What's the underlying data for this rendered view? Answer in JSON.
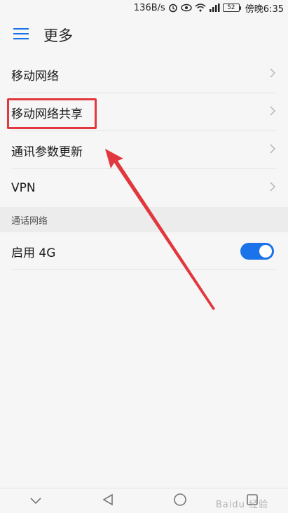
{
  "status_bar": {
    "speed": "136B/s",
    "battery": "52",
    "time": "傍晚6:35"
  },
  "header": {
    "title": "更多"
  },
  "list": {
    "items": [
      {
        "label": "移动网络"
      },
      {
        "label": "移动网络共享"
      },
      {
        "label": "通讯参数更新"
      },
      {
        "label": "VPN"
      }
    ]
  },
  "section": {
    "title": "通话网络"
  },
  "toggle_row": {
    "label": "启用 4G",
    "enabled": true
  },
  "watermark": {
    "text": "Baidu 经验"
  },
  "colors": {
    "accent": "#1a73e8",
    "annotation": "#e0383e"
  }
}
